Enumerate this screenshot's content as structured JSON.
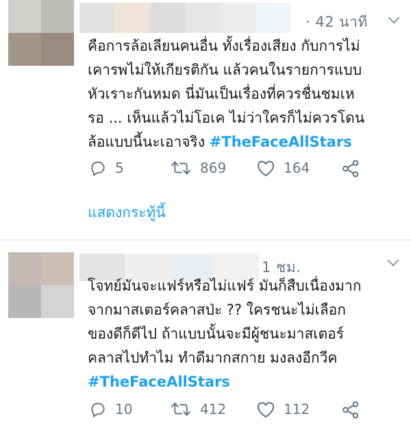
{
  "tweets": [
    {
      "time": "· 42 นาที",
      "text_lines": [
        "คือการล้อเลียนคนอื่น ทั้งเรื่องเสียง กับการไม่",
        "เคารพไม่ให้เกียรติกัน แล้วคนในรายการแบบ",
        "หัวเราะกันหมด นี่มันเป็นเรื่องที่ควรชื่นชมเห",
        "รอ ... เห็นแล้วไม่โอเค ไม่ว่าใครก็ไม่ควรโดน",
        "ล้อแบบนี้นะเอาจริง"
      ],
      "hashtag": "#TheFaceAllStars",
      "reply_count": "5",
      "retweet_count": "869",
      "like_count": "164",
      "show_thread": "แสดงกระทู้นี้"
    },
    {
      "time": "1 ชม.",
      "text_lines": [
        "โจทย์มันจะแฟร์หรือไม่แฟร์ มันก็สืบเนื่องมาก",
        "จากมาสเตอร์คลาสป่ะ ?? ใครชนะไม่เลือก",
        "ของดีก็ดีไป ถ้าแบบนั้นจะมีผู้ชนะมาสเตอร์",
        "คลาสไปทำไม ทำดีมากสกาย มงลงอีกวีค"
      ],
      "hashtag": "#TheFaceAllStars",
      "reply_count": "10",
      "retweet_count": "412",
      "like_count": "112"
    }
  ],
  "icons": [
    "reply-icon",
    "retweet-icon",
    "like-icon",
    "share-icon",
    "chevron-down-icon"
  ],
  "colors": {
    "link": "#1da1f2",
    "muted": "#657786",
    "text": "#14171a",
    "divider": "#e6ecf0"
  }
}
